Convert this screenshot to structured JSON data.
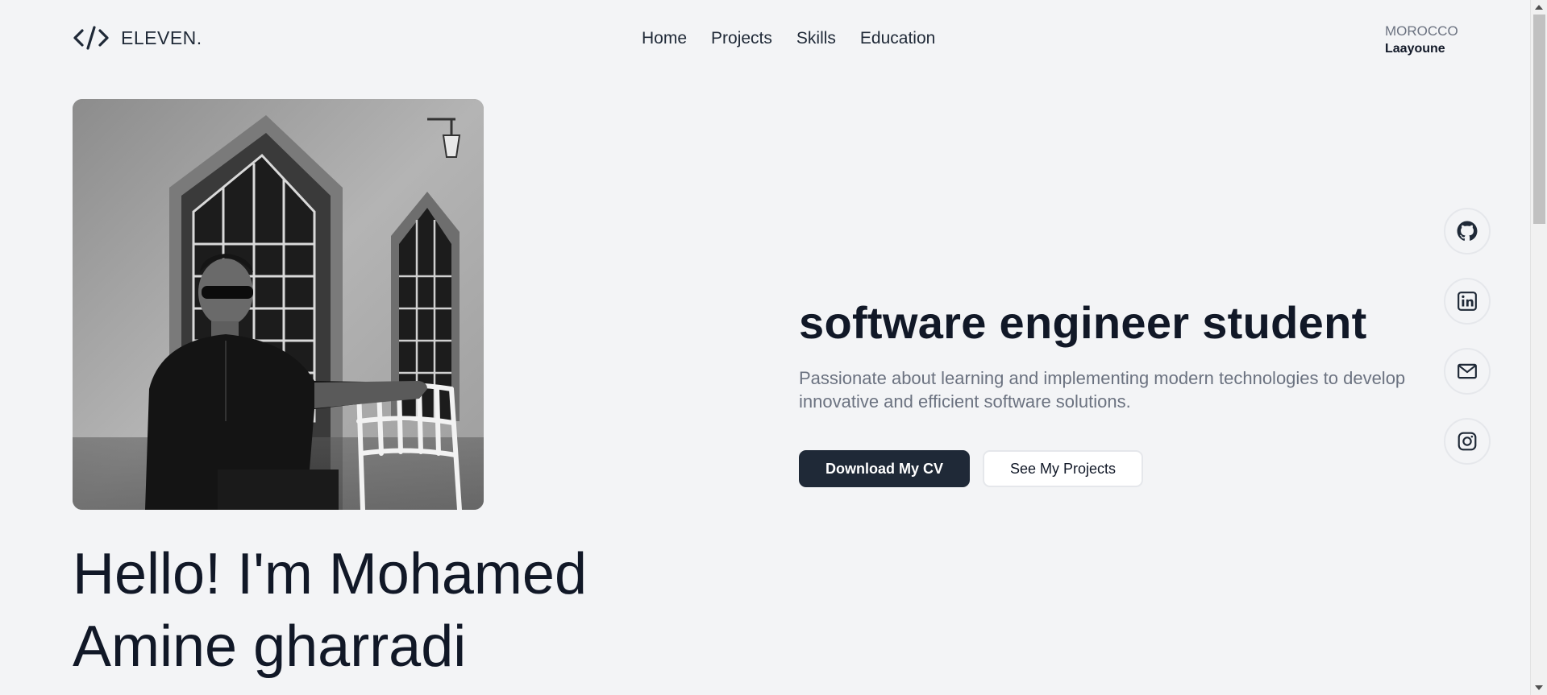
{
  "header": {
    "logo_text": "ELEVEN.",
    "nav": [
      "Home",
      "Projects",
      "Skills",
      "Education"
    ],
    "location": {
      "country": "MOROCCO",
      "city": "Laayoune"
    }
  },
  "hero": {
    "greeting_line1": "Hello! I'm Mohamed",
    "greeting_line2": "Amine gharradi",
    "role": "software engineer student",
    "description": "Passionate about learning and implementing modern technologies to develop innovative and efficient software solutions.",
    "primary_button": "Download My CV",
    "secondary_button": "See My Projects"
  },
  "social": [
    "github-icon",
    "linkedin-icon",
    "mail-icon",
    "instagram-icon"
  ],
  "colors": {
    "background": "#f3f4f6",
    "primary": "#1f2937",
    "muted_text": "#6b7280"
  }
}
